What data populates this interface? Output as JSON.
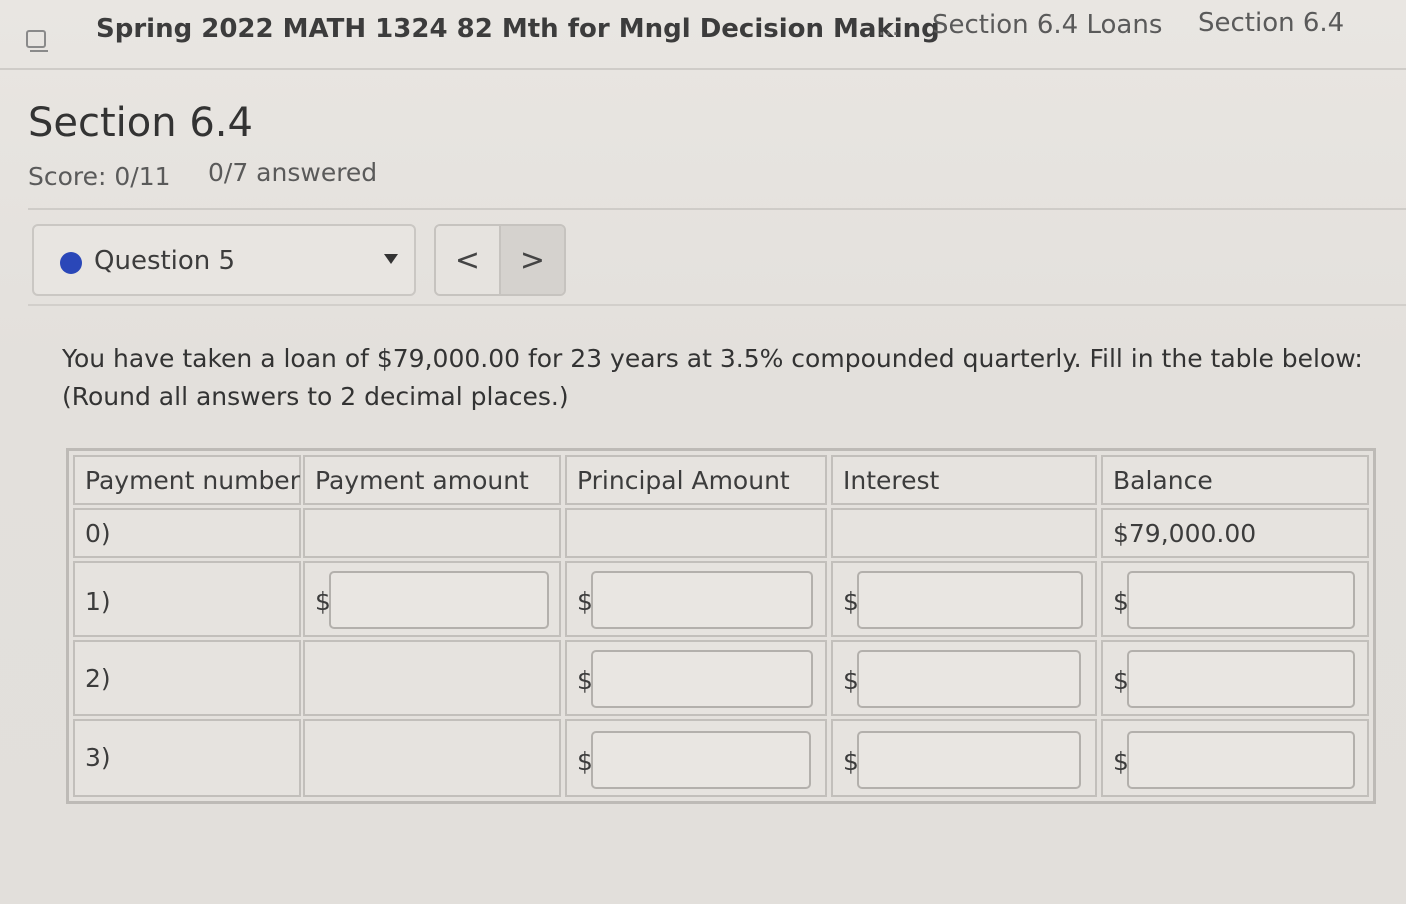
{
  "breadcrumb": {
    "course": "Spring 2022 MATH 1324 82 Mth for Mngl Decision Making",
    "ellipsis": "...",
    "assignment": "Section 6.4 Loans",
    "current": "Section 6.4"
  },
  "header": {
    "title": "Section 6.4",
    "score": "Score: 0/11",
    "answered": "0/7 answered"
  },
  "question_nav": {
    "current": "Question 5",
    "prev_icon": "chevron-left-icon",
    "next_icon": "chevron-right-icon",
    "prev_glyph": "<",
    "next_glyph": ">"
  },
  "question": {
    "text": "You have taken a loan of $79,000.00 for 23 years at 3.5% compounded quarterly. Fill in the table below: (Round all answers to 2 decimal places.)"
  },
  "table": {
    "headers": [
      "Payment number",
      "Payment amount",
      "Principal Amount",
      "Interest",
      "Balance"
    ],
    "currency_symbol": "$",
    "rows": [
      {
        "label": "0)",
        "balance": "$79,000.00"
      },
      {
        "label": "1)",
        "payment": "",
        "principal": "",
        "interest": "",
        "balance": ""
      },
      {
        "label": "2)",
        "principal": "",
        "interest": "",
        "balance": ""
      },
      {
        "label": "3)",
        "principal": "",
        "interest": "",
        "balance": ""
      }
    ]
  },
  "colors": {
    "status_dot": "#2a47b8",
    "background": "#e2dfdb"
  }
}
